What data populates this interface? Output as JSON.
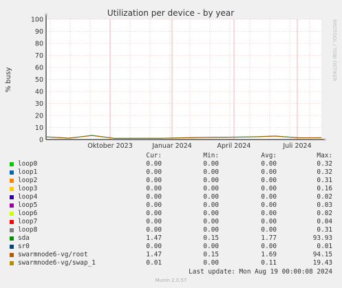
{
  "chart_data": {
    "type": "line",
    "title": "Utilization per device - by year",
    "ylabel": "% busy",
    "xlabel": "",
    "ylim": [
      0,
      100
    ],
    "y_ticks": [
      0,
      10,
      20,
      30,
      40,
      50,
      60,
      70,
      80,
      90,
      100
    ],
    "x_tick_labels": [
      "Oktober 2023",
      "Januar 2024",
      "April 2024",
      "Juli 2024"
    ],
    "x": [
      "2023-08",
      "2023-09",
      "2023-10",
      "2023-11",
      "2023-12",
      "2024-01",
      "2024-02",
      "2024-03",
      "2024-04",
      "2024-05",
      "2024-06",
      "2024-07",
      "2024-08"
    ],
    "series": [
      {
        "name": "sda",
        "color": "#008f00",
        "values": [
          2.3,
          1.2,
          3.5,
          1.0,
          1.1,
          1.1,
          1.5,
          1.8,
          2.0,
          2.3,
          2.9,
          1.5,
          1.5
        ]
      },
      {
        "name": "swarmnode6-vg/root",
        "color": "#b35900",
        "values": [
          2.1,
          1.1,
          3.3,
          0.9,
          1.0,
          1.0,
          1.4,
          1.7,
          1.9,
          2.2,
          2.8,
          1.4,
          1.5
        ]
      }
    ],
    "grid": true,
    "legend_placement": "bottom"
  },
  "side_label": "RRDTOOL / TOBI OETIKER",
  "legend": {
    "headers": {
      "cur": "Cur:",
      "min": "Min:",
      "avg": "Avg:",
      "max": "Max:"
    },
    "rows": [
      {
        "name": "loop0",
        "color": "#00cc00",
        "cur": "0.00",
        "min": "0.00",
        "avg": "0.00",
        "max": "0.32"
      },
      {
        "name": "loop1",
        "color": "#0066b3",
        "cur": "0.00",
        "min": "0.00",
        "avg": "0.00",
        "max": "0.32"
      },
      {
        "name": "loop2",
        "color": "#ff8000",
        "cur": "0.00",
        "min": "0.00",
        "avg": "0.00",
        "max": "0.31"
      },
      {
        "name": "loop3",
        "color": "#ffcc00",
        "cur": "0.00",
        "min": "0.00",
        "avg": "0.00",
        "max": "0.16"
      },
      {
        "name": "loop4",
        "color": "#330099",
        "cur": "0.00",
        "min": "0.00",
        "avg": "0.00",
        "max": "0.02"
      },
      {
        "name": "loop5",
        "color": "#990099",
        "cur": "0.00",
        "min": "0.00",
        "avg": "0.00",
        "max": "0.03"
      },
      {
        "name": "loop6",
        "color": "#ccff00",
        "cur": "0.00",
        "min": "0.00",
        "avg": "0.00",
        "max": "0.02"
      },
      {
        "name": "loop7",
        "color": "#ff0000",
        "cur": "0.00",
        "min": "0.00",
        "avg": "0.00",
        "max": "0.04"
      },
      {
        "name": "loop8",
        "color": "#808080",
        "cur": "0.00",
        "min": "0.00",
        "avg": "0.00",
        "max": "0.31"
      },
      {
        "name": "sda",
        "color": "#008f00",
        "cur": "1.47",
        "min": "0.15",
        "avg": "1.77",
        "max": "93.93"
      },
      {
        "name": "sr0",
        "color": "#00487d",
        "cur": "0.00",
        "min": "0.00",
        "avg": "0.00",
        "max": "0.01"
      },
      {
        "name": "swarmnode6-vg/root",
        "color": "#b35900",
        "cur": "1.47",
        "min": "0.15",
        "avg": "1.69",
        "max": "94.15"
      },
      {
        "name": "swarmnode6-vg/swap_1",
        "color": "#b38f00",
        "cur": "0.01",
        "min": "0.00",
        "avg": "0.11",
        "max": "19.43"
      }
    ]
  },
  "last_update": "Last update: Mon Aug 19 00:00:08 2024",
  "footer": "Munin 2.0.57"
}
